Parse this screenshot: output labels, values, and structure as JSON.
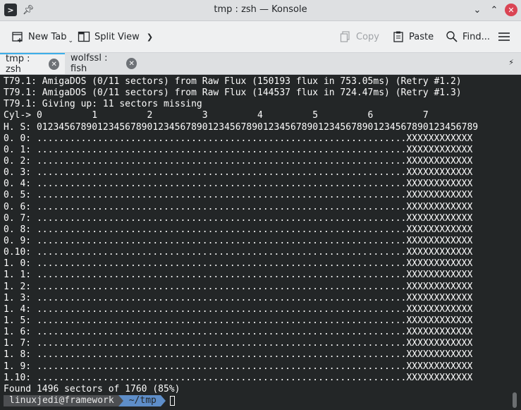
{
  "window": {
    "title": "tmp : zsh — Konsole",
    "app_icon": "terminal-icon",
    "pin_icon": "pin-icon",
    "controls": {
      "minimize": "⌄",
      "maximize": "⌃",
      "close": "✕"
    }
  },
  "toolbar": {
    "new_tab": "New Tab",
    "split_view": "Split View",
    "copy": "Copy",
    "paste": "Paste",
    "find": "Find..."
  },
  "tabs": [
    {
      "label": "tmp : zsh",
      "active": true
    },
    {
      "label": "wolfssl : fish",
      "active": false
    }
  ],
  "terminal": {
    "lines": [
      "T79.1: AmigaDOS (0/11 sectors) from Raw Flux (150193 flux in 753.05ms) (Retry #1.2)",
      "T79.1: AmigaDOS (0/11 sectors) from Raw Flux (144537 flux in 724.47ms) (Retry #1.3)",
      "T79.1: Giving up: 11 sectors missing",
      "Cyl-> 0         1         2         3         4         5         6         7",
      "H. S: 01234567890123456789012345678901234567890123456789012345678901234567890123456789",
      "0. 0: ...................................................................XXXXXXXXXXXX",
      "0. 1: ...................................................................XXXXXXXXXXXX",
      "0. 2: ...................................................................XXXXXXXXXXXX",
      "0. 3: ...................................................................XXXXXXXXXXXX",
      "0. 4: ...................................................................XXXXXXXXXXXX",
      "0. 5: ...................................................................XXXXXXXXXXXX",
      "0. 6: ...................................................................XXXXXXXXXXXX",
      "0. 7: ...................................................................XXXXXXXXXXXX",
      "0. 8: ...................................................................XXXXXXXXXXXX",
      "0. 9: ...................................................................XXXXXXXXXXXX",
      "0.10: ...................................................................XXXXXXXXXXXX",
      "1. 0: ...................................................................XXXXXXXXXXXX",
      "1. 1: ...................................................................XXXXXXXXXXXX",
      "1. 2: ...................................................................XXXXXXXXXXXX",
      "1. 3: ...................................................................XXXXXXXXXXXX",
      "1. 4: ...................................................................XXXXXXXXXXXX",
      "1. 5: ...................................................................XXXXXXXXXXXX",
      "1. 6: ...................................................................XXXXXXXXXXXX",
      "1. 7: ...................................................................XXXXXXXXXXXX",
      "1. 8: ...................................................................XXXXXXXXXXXX",
      "1. 9: ...................................................................XXXXXXXXXXXX",
      "1.10: ...................................................................XXXXXXXXXXXX",
      "Found 1496 sectors of 1760 (85%)"
    ],
    "prompt_user": "linuxjedi@framework",
    "prompt_dir": "~/tmp"
  },
  "colors": {
    "terminal_bg": "#232627",
    "terminal_fg": "#fcfcfc",
    "accent": "#3daee9",
    "close_button": "#da4453",
    "prompt_dir_bg": "#5e8ec9"
  }
}
